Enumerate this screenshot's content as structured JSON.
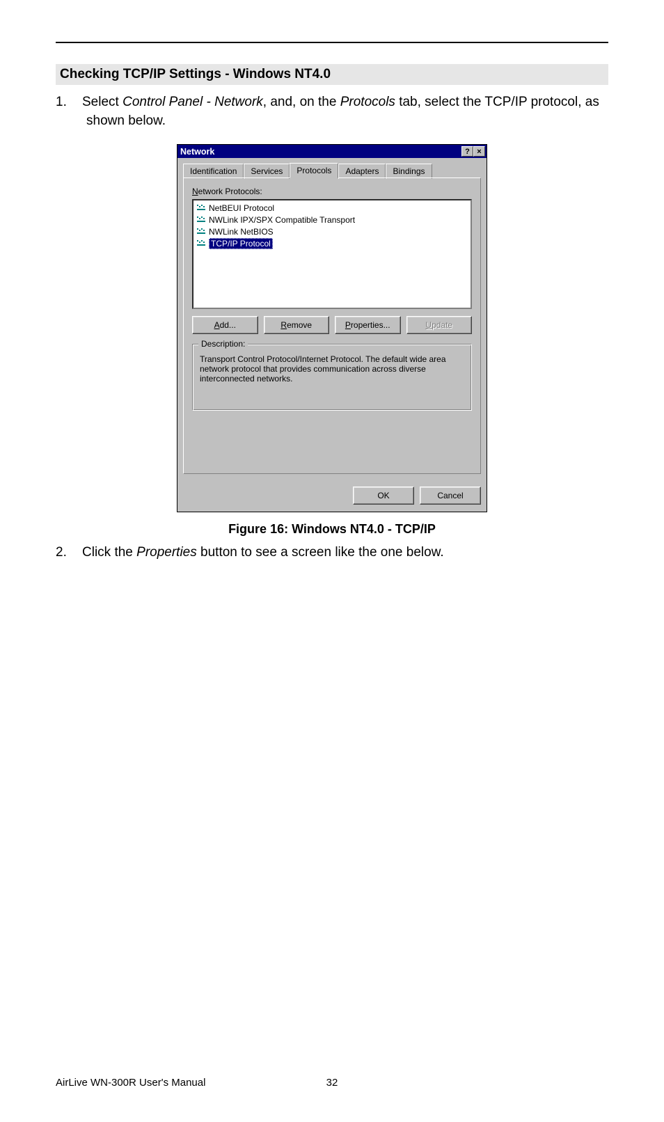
{
  "heading": "Checking TCP/IP Settings - Windows NT4.0",
  "step1": {
    "num": "1.",
    "pre": "Select ",
    "em": "Control Panel - Network",
    "mid": ", and, on the ",
    "em2": "Protocols",
    "post": " tab, select the TCP/IP protocol, as shown below."
  },
  "dialog": {
    "title": "Network",
    "help_glyph": "?",
    "close_glyph": "×",
    "tabs": [
      "Identification",
      "Services",
      "Protocols",
      "Adapters",
      "Bindings"
    ],
    "active_tab_index": 2,
    "list_label_pre": "N",
    "list_label_post": "etwork Protocols:",
    "protocols": [
      "NetBEUI Protocol",
      "NWLink IPX/SPX Compatible Transport",
      "NWLink NetBIOS",
      "TCP/IP Protocol"
    ],
    "selected_index": 3,
    "buttons": {
      "add_u": "A",
      "add": "dd...",
      "remove_u": "R",
      "remove": "emove",
      "props_u": "P",
      "props": "roperties...",
      "update_u": "U",
      "update": "pdate"
    },
    "desc_legend": "Description:",
    "desc_text": "Transport Control Protocol/Internet Protocol. The default wide area network protocol that provides communication across diverse interconnected networks.",
    "ok": "OK",
    "cancel": "Cancel"
  },
  "figure_caption": "Figure 16: Windows NT4.0 - TCP/IP",
  "step2": {
    "num": "2.",
    "pre": "Click the ",
    "em": "Properties",
    "post": " button to see a screen like the one below."
  },
  "footer_text": "AirLive WN-300R User's Manual",
  "page_number": "32"
}
